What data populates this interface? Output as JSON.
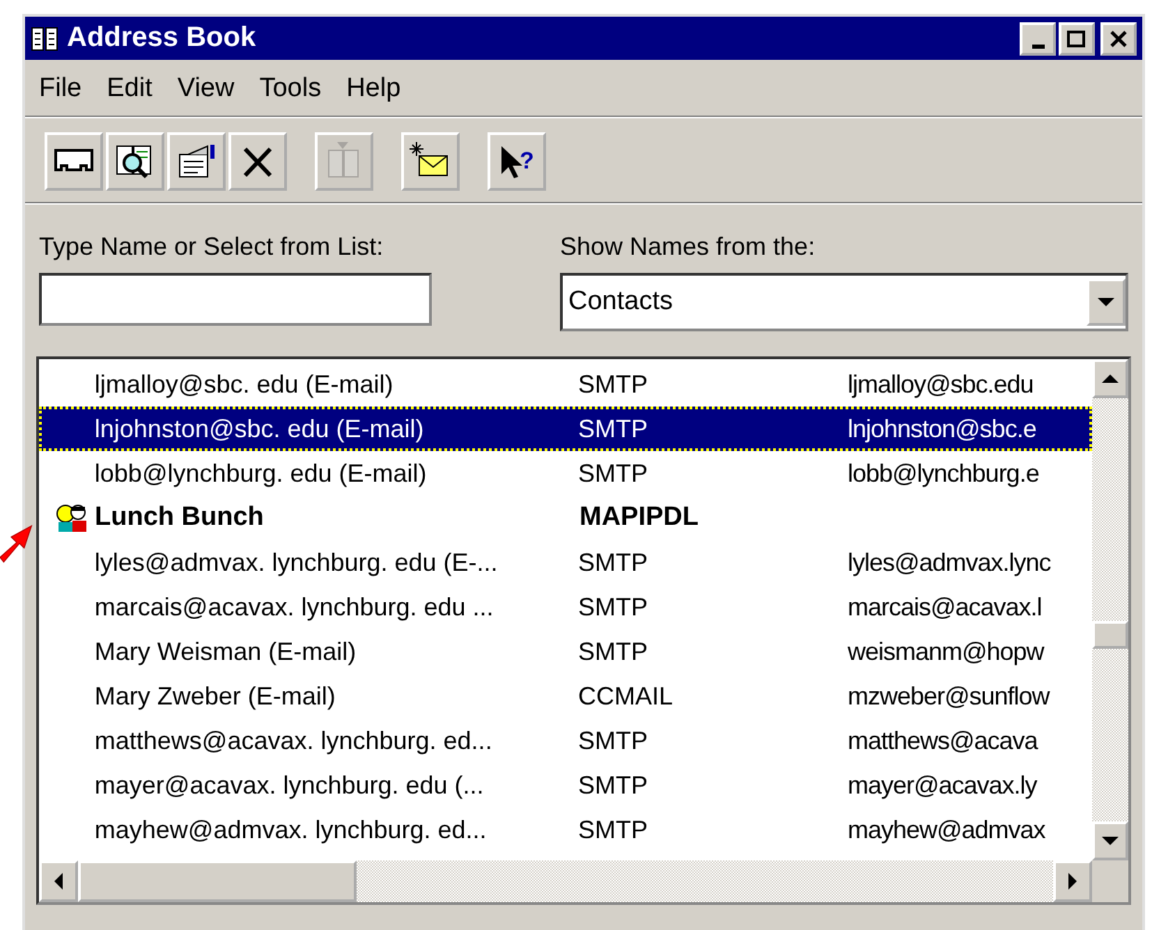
{
  "window": {
    "title": "Address Book"
  },
  "menu": [
    "File",
    "Edit",
    "View",
    "Tools",
    "Help"
  ],
  "toolbar": [
    {
      "kind": "card",
      "disabled": false
    },
    {
      "kind": "find",
      "disabled": false
    },
    {
      "kind": "properties",
      "disabled": false
    },
    {
      "kind": "delete",
      "disabled": false
    },
    {
      "kind": "book",
      "disabled": true
    },
    {
      "kind": "mail",
      "disabled": false
    },
    {
      "kind": "help",
      "disabled": false,
      "glyph": "?"
    }
  ],
  "search": {
    "label": "Type Name or Select from List:"
  },
  "source": {
    "label": "Show Names from the:",
    "value": "Contacts"
  },
  "list": {
    "rows": [
      {
        "kind": "contact",
        "selected": false,
        "name": "ljmalloy@sbc. edu (E-mail)",
        "type": "SMTP",
        "address": "ljmalloy@sbc.edu"
      },
      {
        "kind": "contact",
        "selected": true,
        "name": "lnjohnston@sbc. edu (E-mail)",
        "type": "SMTP",
        "address": "lnjohnston@sbc.e"
      },
      {
        "kind": "contact",
        "selected": false,
        "name": "lobb@lynchburg. edu (E-mail)",
        "type": "SMTP",
        "address": "lobb@lynchburg.e"
      },
      {
        "kind": "group",
        "selected": false,
        "name": "Lunch Bunch",
        "type": "MAPIPDL",
        "address": ""
      },
      {
        "kind": "contact",
        "selected": false,
        "name": "lyles@admvax. lynchburg. edu (E-...",
        "type": "SMTP",
        "address": "lyles@admvax.lync"
      },
      {
        "kind": "contact",
        "selected": false,
        "name": "marcais@acavax. lynchburg. edu ...",
        "type": "SMTP",
        "address": "marcais@acavax.l"
      },
      {
        "kind": "contact",
        "selected": false,
        "name": "Mary Weisman (E-mail)",
        "type": "SMTP",
        "address": "weismanm@hopw"
      },
      {
        "kind": "contact",
        "selected": false,
        "name": "Mary Zweber (E-mail)",
        "type": "CCMAIL",
        "address": "mzweber@sunflow"
      },
      {
        "kind": "contact",
        "selected": false,
        "name": "matthews@acavax. lynchburg. ed...",
        "type": "SMTP",
        "address": "matthews@acava"
      },
      {
        "kind": "contact",
        "selected": false,
        "name": "mayer@acavax. lynchburg. edu (...",
        "type": "SMTP",
        "address": "mayer@acavax.ly"
      },
      {
        "kind": "contact",
        "selected": false,
        "name": "mayhew@admvax. lynchburg. ed...",
        "type": "SMTP",
        "address": "mayhew@admvax"
      }
    ]
  }
}
